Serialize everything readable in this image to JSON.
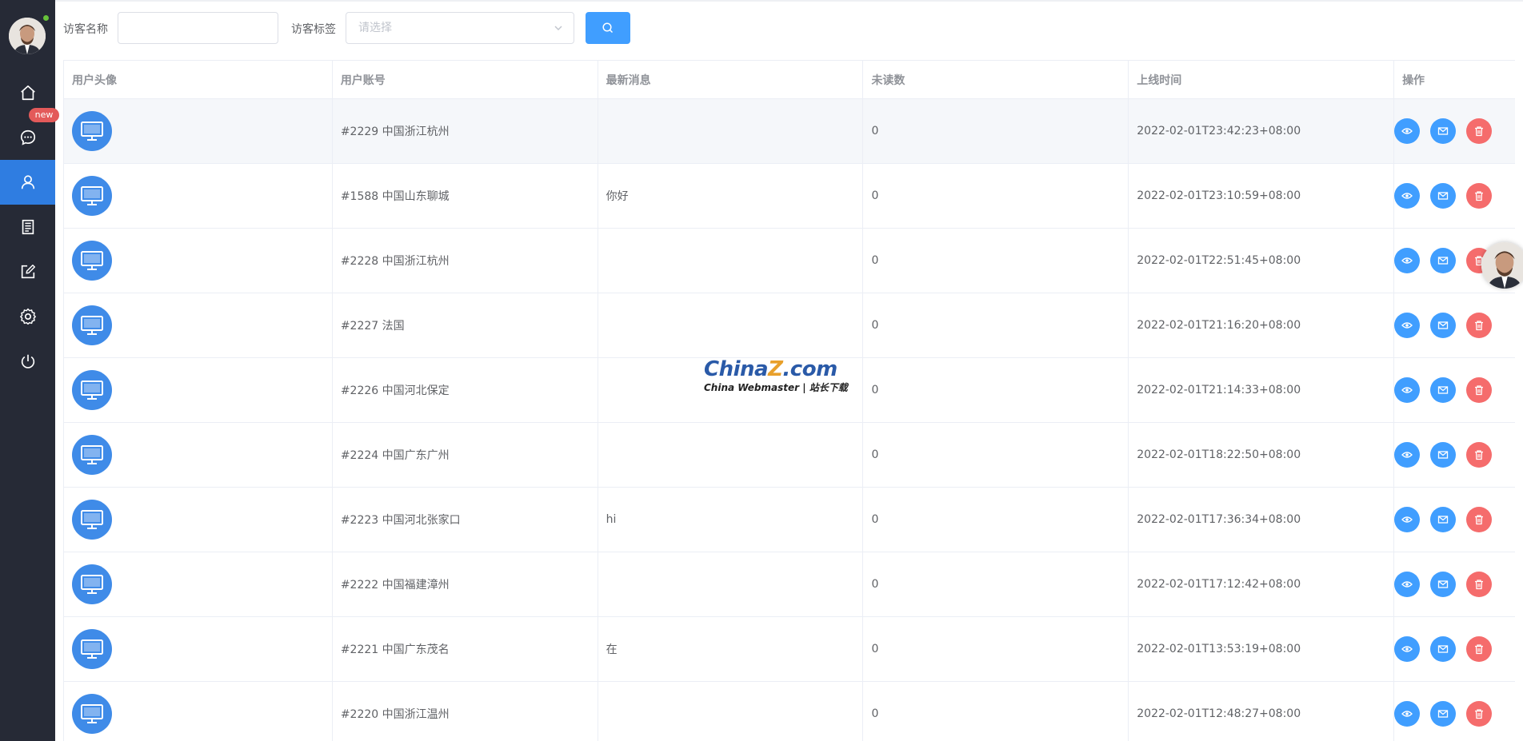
{
  "sidebar": {
    "new_badge": "new",
    "items": [
      {
        "icon": "home-icon"
      },
      {
        "icon": "chat-icon"
      },
      {
        "icon": "user-icon"
      },
      {
        "icon": "document-icon"
      },
      {
        "icon": "edit-icon"
      },
      {
        "icon": "settings-icon"
      },
      {
        "icon": "power-icon"
      }
    ],
    "active_index": 2,
    "online_color": "#67c23a"
  },
  "filters": {
    "visitor_name_label": "访客名称",
    "visitor_name_value": "",
    "visitor_tag_label": "访客标签",
    "visitor_tag_placeholder": "请选择"
  },
  "table": {
    "headers": [
      "用户头像",
      "用户账号",
      "最新消息",
      "未读数",
      "上线时间",
      "操作"
    ],
    "rows": [
      {
        "account": "#2229 中国浙江杭州",
        "message": "",
        "unread": "0",
        "online_time": "2022-02-01T23:42:23+08:00"
      },
      {
        "account": "#1588 中国山东聊城",
        "message": "你好",
        "unread": "0",
        "online_time": "2022-02-01T23:10:59+08:00"
      },
      {
        "account": "#2228 中国浙江杭州",
        "message": "",
        "unread": "0",
        "online_time": "2022-02-01T22:51:45+08:00"
      },
      {
        "account": "#2227 法国",
        "message": "",
        "unread": "0",
        "online_time": "2022-02-01T21:16:20+08:00"
      },
      {
        "account": "#2226 中国河北保定",
        "message": "",
        "unread": "0",
        "online_time": "2022-02-01T21:14:33+08:00"
      },
      {
        "account": "#2224 中国广东广州",
        "message": "",
        "unread": "0",
        "online_time": "2022-02-01T18:22:50+08:00"
      },
      {
        "account": "#2223 中国河北张家口",
        "message": "hi",
        "unread": "0",
        "online_time": "2022-02-01T17:36:34+08:00"
      },
      {
        "account": "#2222 中国福建漳州",
        "message": "",
        "unread": "0",
        "online_time": "2022-02-01T17:12:42+08:00"
      },
      {
        "account": "#2221 中国广东茂名",
        "message": "在",
        "unread": "0",
        "online_time": "2022-02-01T13:53:19+08:00"
      },
      {
        "account": "#2220 中国浙江温州",
        "message": "",
        "unread": "0",
        "online_time": "2022-02-01T12:48:27+08:00"
      }
    ]
  },
  "watermark": {
    "main_prefix": "China",
    "main_z": "Z",
    "main_suffix": ".com",
    "sub": "China Webmaster | 站长下载"
  },
  "colors": {
    "sidebar_bg": "#262a36",
    "active": "#2f7de1",
    "primary": "#409eff",
    "danger": "#f56c6c",
    "badge": "#e35a5a"
  }
}
